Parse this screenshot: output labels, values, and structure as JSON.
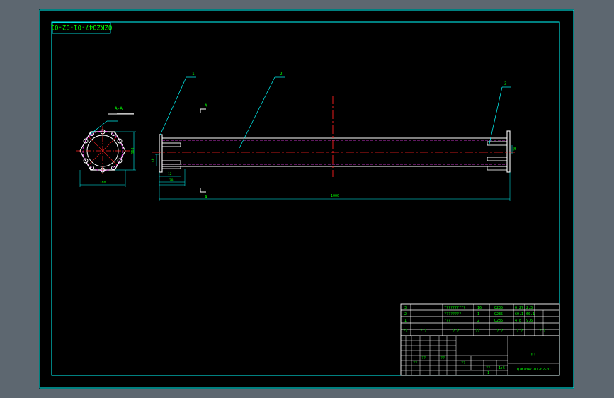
{
  "drawing": {
    "number_mirrored": "QZKZ047-01-02-01",
    "number": "QZKZ047-01-02-01",
    "section_title": "A-A",
    "section_mark": "A",
    "balloons": [
      "1",
      "2",
      "3"
    ],
    "dim_width": "180",
    "dim_height": "160",
    "dim_length": "1000",
    "dim_small_a": "12",
    "dim_small_b": "20",
    "dim_small_c": "40",
    "dim_right": "20"
  },
  "bom": {
    "rows": [
      {
        "no": "3",
        "name": "??????????",
        "qty": "16",
        "material": "Q235",
        "weight": "0.27",
        "total": "2.3"
      },
      {
        "no": "2",
        "name": "????????",
        "qty": "1",
        "material": "Q235",
        "weight": "60.1",
        "total": "60.1"
      },
      {
        "no": "1",
        "name": "???",
        "qty": "2",
        "material": "Q235",
        "weight": "4.8",
        "total": "9.6"
      }
    ],
    "header": {
      "no": "??",
      "code": "? ?",
      "name": "? ?",
      "qty": "??",
      "material": "? ?",
      "weight": "? ?",
      "total": "? ?"
    }
  },
  "title_block": {
    "title": "!!",
    "number": "QZKZ047-01-02-01",
    "scale_label": "??",
    "scale": "1:5",
    "stage": "??",
    "sheet": "1",
    "rev_cells": [
      "??",
      "??",
      "??"
    ]
  },
  "colors": {
    "background": "#000000",
    "border": "#00ffff",
    "outline": "#ffffff",
    "center_line": "#ff2020",
    "hidden_line": "#ff40ff",
    "text": "#00ff00",
    "leader": "#00ffff"
  }
}
